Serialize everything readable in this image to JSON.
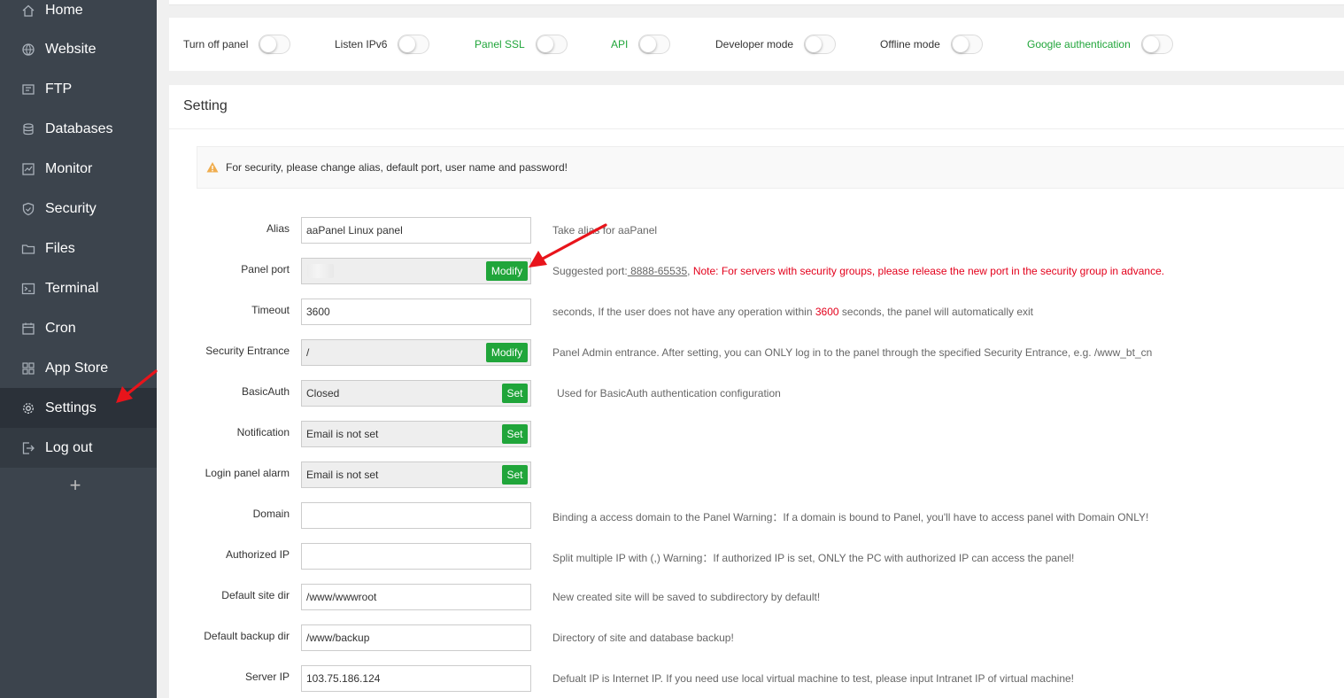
{
  "sidebar": {
    "items": [
      {
        "label": "Home",
        "icon": "home-icon"
      },
      {
        "label": "Website",
        "icon": "globe-icon"
      },
      {
        "label": "FTP",
        "icon": "ftp-icon"
      },
      {
        "label": "Databases",
        "icon": "database-icon"
      },
      {
        "label": "Monitor",
        "icon": "monitor-icon"
      },
      {
        "label": "Security",
        "icon": "shield-icon"
      },
      {
        "label": "Files",
        "icon": "folder-icon"
      },
      {
        "label": "Terminal",
        "icon": "terminal-icon"
      },
      {
        "label": "Cron",
        "icon": "calendar-icon"
      },
      {
        "label": "App Store",
        "icon": "grid-icon"
      },
      {
        "label": "Settings",
        "icon": "gear-icon",
        "active": true
      },
      {
        "label": "Log out",
        "icon": "logout-icon"
      }
    ],
    "add": "+"
  },
  "toggles": [
    {
      "label": "Turn off panel",
      "on": false
    },
    {
      "label": "Listen IPv6",
      "on": false
    },
    {
      "label": "Panel SSL",
      "on": false,
      "accent": "#20a53a"
    },
    {
      "label": "API",
      "on": false,
      "accent": "#20a53a"
    },
    {
      "label": "Developer mode",
      "on": false
    },
    {
      "label": "Offline mode",
      "on": false
    },
    {
      "label": "Google authentication",
      "on": false,
      "accent": "#20a53a"
    }
  ],
  "setting": {
    "title": "Setting",
    "warning": "For security, please change alias, default port, user name and password!",
    "rows": {
      "alias": {
        "label": "Alias",
        "value": "aaPanel Linux panel",
        "hint": "Take alias for aaPanel"
      },
      "port": {
        "label": "Panel port",
        "value": "",
        "button": "Modify",
        "hint_prefix": "Suggested port:",
        "hint_range": " 8888-65535",
        "hint_sep": ", ",
        "hint_note": "Note: For servers with security groups, please release the new port in the security group in advance."
      },
      "timeout": {
        "label": "Timeout",
        "value": "3600",
        "hint_a": "seconds, If the user does not have any operation within ",
        "hint_num": "3600",
        "hint_b": " seconds, the panel will automatically exit"
      },
      "entrance": {
        "label": "Security Entrance",
        "value": "/",
        "button": "Modify",
        "hint": "Panel Admin entrance. After setting, you can ONLY log in to the panel through the specified Security Entrance, e.g. /www_bt_cn"
      },
      "basicauth": {
        "label": "BasicAuth",
        "value": "Closed",
        "button": "Set",
        "hint": "Used for BasicAuth authentication configuration"
      },
      "notification": {
        "label": "Notification",
        "value": "Email is not set",
        "button": "Set"
      },
      "loginalarm": {
        "label": "Login panel alarm",
        "value": "Email is not set",
        "button": "Set"
      },
      "domain": {
        "label": "Domain",
        "value": "",
        "hint": "Binding a access domain to the Panel Warning：If a domain is bound to Panel, you'll have to access panel with Domain ONLY!"
      },
      "authip": {
        "label": "Authorized IP",
        "value": "",
        "hint": "Split multiple IP with (,) Warning：If authorized IP is set, ONLY the PC with authorized IP can access the panel!"
      },
      "sitedir": {
        "label": "Default site dir",
        "value": "/www/wwwroot",
        "hint": "New created site will be saved to subdirectory by default!"
      },
      "backupdir": {
        "label": "Default backup dir",
        "value": "/www/backup",
        "hint": "Directory of site and database backup!"
      },
      "serverip": {
        "label": "Server IP",
        "value": "103.75.186.124",
        "hint": "Defualt IP is Internet IP. If you need use local virtual machine to test, please input Intranet IP of virtual machine!"
      }
    }
  },
  "colors": {
    "green": "#20a53a",
    "red": "#e3001b",
    "sidebar": "#3c444d",
    "annotation_arrow": "#e8141b"
  }
}
